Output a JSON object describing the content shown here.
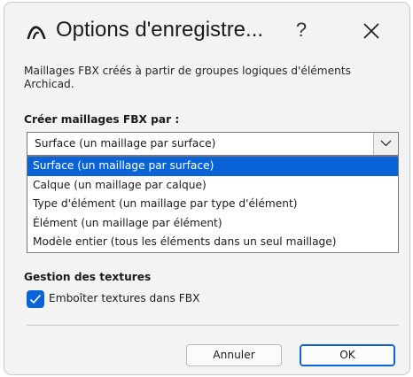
{
  "dialog": {
    "title": "Options d'enregistre...",
    "help_label": "?",
    "description": "Maillages FBX créés à partir de groupes logiques d'éléments Archicad.",
    "create_mesh_label": "Créer maillages FBX par :",
    "select_value": "Surface (un maillage par surface)",
    "options": [
      "Surface (un maillage par surface)",
      "Calque (un maillage par calque)",
      "Type d'élément (un maillage par type d'élément)",
      "Élément (un maillage par élément)",
      "Modèle entier (tous les éléments dans un seul maillage)"
    ],
    "selected_index": 0,
    "textures_label": "Gestion des textures",
    "embed_textures_label": "Emboîter textures dans FBX",
    "embed_textures_checked": true,
    "cancel_label": "Annuler",
    "ok_label": "OK"
  },
  "colors": {
    "accent": "#0a64d8",
    "background": "#f3f3f3"
  },
  "icons": {
    "app": "archicad-logo-icon",
    "close": "close-icon",
    "dropdown": "chevron-down-icon",
    "check": "checkmark-icon"
  }
}
